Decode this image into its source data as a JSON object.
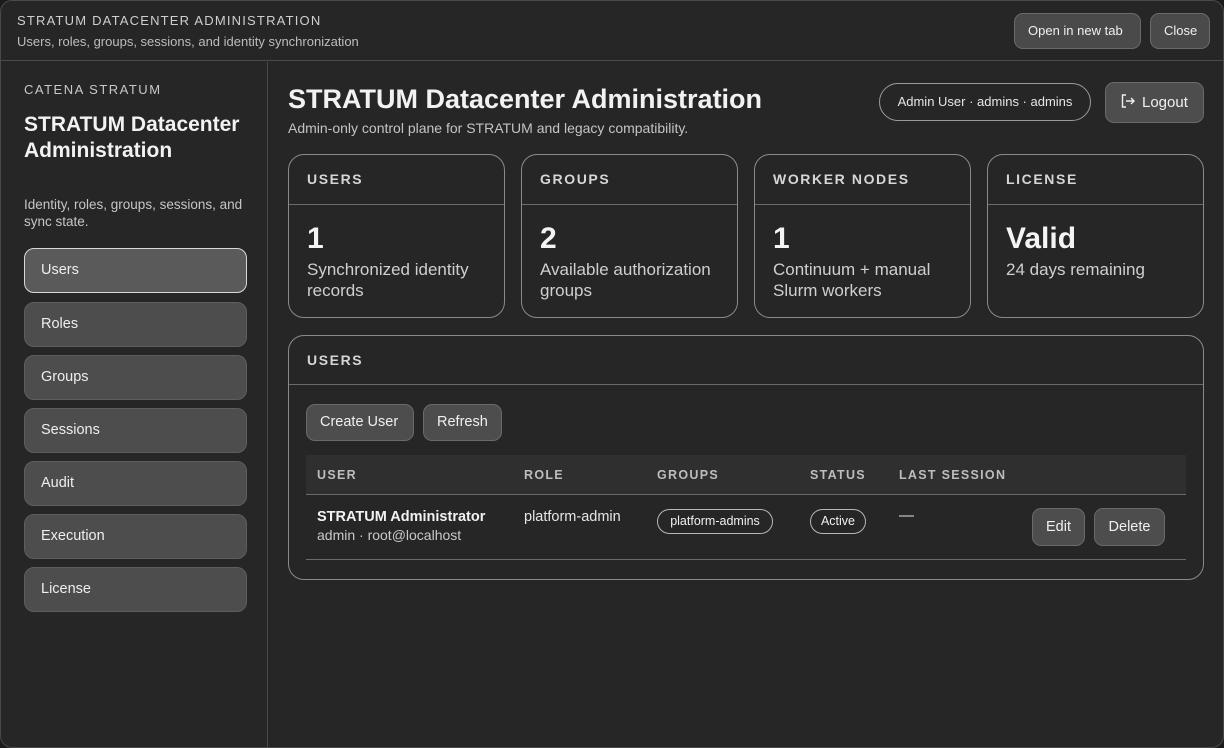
{
  "titlebar": {
    "title": "STRATUM DATACENTER ADMINISTRATION",
    "subtitle": "Users, roles, groups, sessions, and identity synchronization",
    "open_new_tab": "Open in new tab",
    "close": "Close"
  },
  "sidebar": {
    "brand": "CATENA STRATUM",
    "title": "STRATUM Datacenter Administration",
    "description": "Identity, roles, groups, sessions, and sync state.",
    "items": [
      {
        "label": "Users",
        "active": true
      },
      {
        "label": "Roles"
      },
      {
        "label": "Groups"
      },
      {
        "label": "Sessions"
      },
      {
        "label": "Audit"
      },
      {
        "label": "Execution"
      },
      {
        "label": "License"
      }
    ]
  },
  "header": {
    "title": "STRATUM Datacenter Administration",
    "subtitle": "Admin-only control plane for STRATUM and legacy compatibility.",
    "user_pill": "Admin User · admins · admins",
    "logout": "Logout",
    "logout_icon": "logout-icon"
  },
  "stats": [
    {
      "label": "USERS",
      "value": "1",
      "desc": "Synchronized identity records"
    },
    {
      "label": "GROUPS",
      "value": "2",
      "desc": "Available authorization groups"
    },
    {
      "label": "WORKER NODES",
      "value": "1",
      "desc": "Continuum + manual Slurm workers"
    },
    {
      "label": "LICENSE",
      "value": "Valid",
      "desc": "24 days remaining"
    }
  ],
  "users_panel": {
    "title": "USERS",
    "create_button": "Create User",
    "refresh_button": "Refresh",
    "columns": [
      "USER",
      "ROLE",
      "GROUPS",
      "STATUS",
      "LAST SESSION"
    ],
    "rows": [
      {
        "name": "STRATUM Administrator",
        "detail": "admin · root@localhost",
        "role": "platform-admin",
        "group": "platform-admins",
        "status": "Active",
        "last_session": "—",
        "edit": "Edit",
        "delete": "Delete"
      }
    ]
  }
}
